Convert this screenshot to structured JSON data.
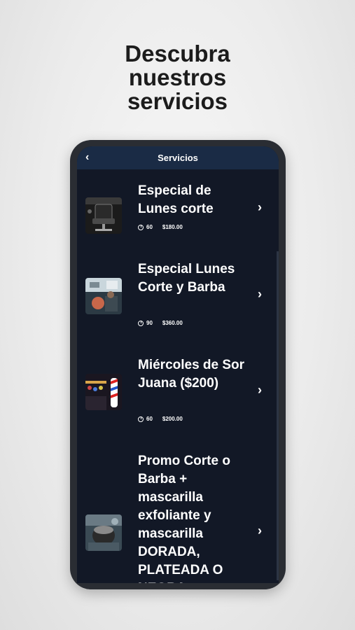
{
  "headline": [
    "Descubra",
    "nuestros",
    "servicios"
  ],
  "appbar": {
    "back_glyph": "‹",
    "title": "Servicios"
  },
  "services": [
    {
      "name": "Especial de Lunes corte",
      "duration": "60",
      "price": "$180.00",
      "thumb": "barber-chair-photo"
    },
    {
      "name": "Especial Lunes Corte y Barba",
      "duration": "90",
      "price": "$360.00",
      "thumb": "barbershop-photo"
    },
    {
      "name": "Miércoles de Sor Juana ($200)",
      "duration": "60",
      "price": "$200.00",
      "thumb": "barber-pole-photo"
    },
    {
      "name": "Promo Corte o Barba + mascarilla exfoliante y mascarilla DORADA, PLATEADA O NEGRA",
      "duration": "",
      "price": "",
      "thumb": "face-mask-photo"
    }
  ],
  "icons": {
    "clock": "clock-icon",
    "chevron": "chevron-right-icon",
    "back": "chevron-left-icon"
  },
  "colors": {
    "screen_bg": "#121826",
    "appbar_bg": "#1a2b45",
    "text": "#ffffff"
  }
}
